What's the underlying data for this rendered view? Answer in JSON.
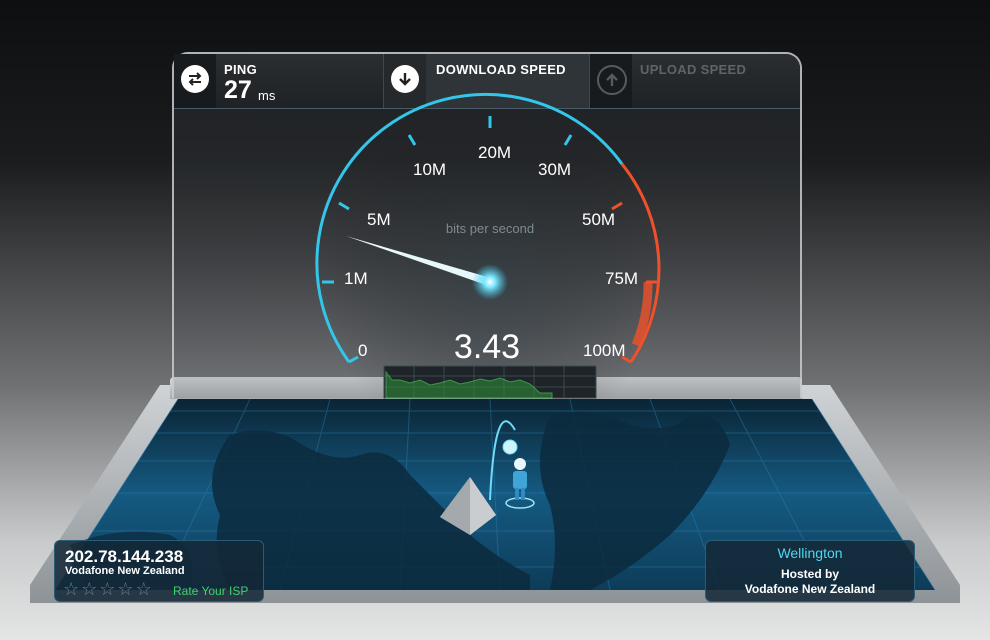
{
  "header": {
    "ping_label": "PING",
    "ping_value": "27",
    "ping_unit": "ms",
    "download_label": "DOWNLOAD SPEED",
    "upload_label": "UPLOAD SPEED"
  },
  "gauge": {
    "unit_label": "bits per second",
    "current_value": "3.43",
    "ticks": [
      "0",
      "1M",
      "5M",
      "10M",
      "20M",
      "30M",
      "50M",
      "75M",
      "100M"
    ],
    "accent_color": "#34c6ea",
    "high_color": "#f0502a"
  },
  "client": {
    "ip": "202.78.144.238",
    "isp": "Vodafone New Zealand",
    "stars": 5,
    "rate_label": "Rate Your ISP"
  },
  "server": {
    "city": "Wellington",
    "hosted_label": "Hosted by",
    "host": "Vodafone New Zealand"
  },
  "icons": {
    "ping": "swap-arrows-icon",
    "download": "arrow-down-circle-icon",
    "upload": "arrow-up-circle-icon"
  }
}
